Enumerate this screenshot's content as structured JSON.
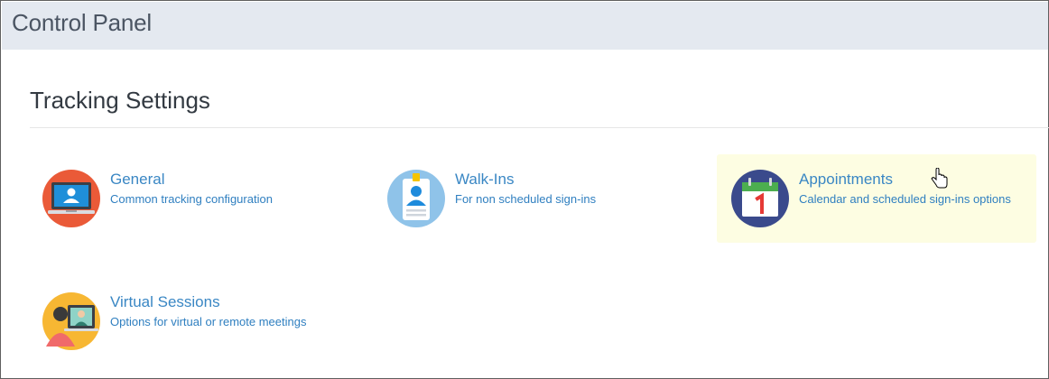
{
  "header": {
    "title": "Control Panel"
  },
  "section": {
    "title": "Tracking Settings"
  },
  "tiles": [
    {
      "title": "General",
      "desc": "Common tracking configuration",
      "icon": "monitor-user-icon"
    },
    {
      "title": "Walk-Ins",
      "desc": "For non scheduled sign-ins",
      "icon": "badge-user-icon"
    },
    {
      "title": "Appointments",
      "desc": "Calendar and scheduled sign-ins options",
      "icon": "calendar-icon"
    },
    {
      "title": "Virtual Sessions",
      "desc": "Options for virtual or remote meetings",
      "icon": "video-meeting-icon"
    }
  ],
  "colors": {
    "header_bg": "#e4e9f0",
    "link": "#3a87c4",
    "highlight": "#fdfde2"
  }
}
